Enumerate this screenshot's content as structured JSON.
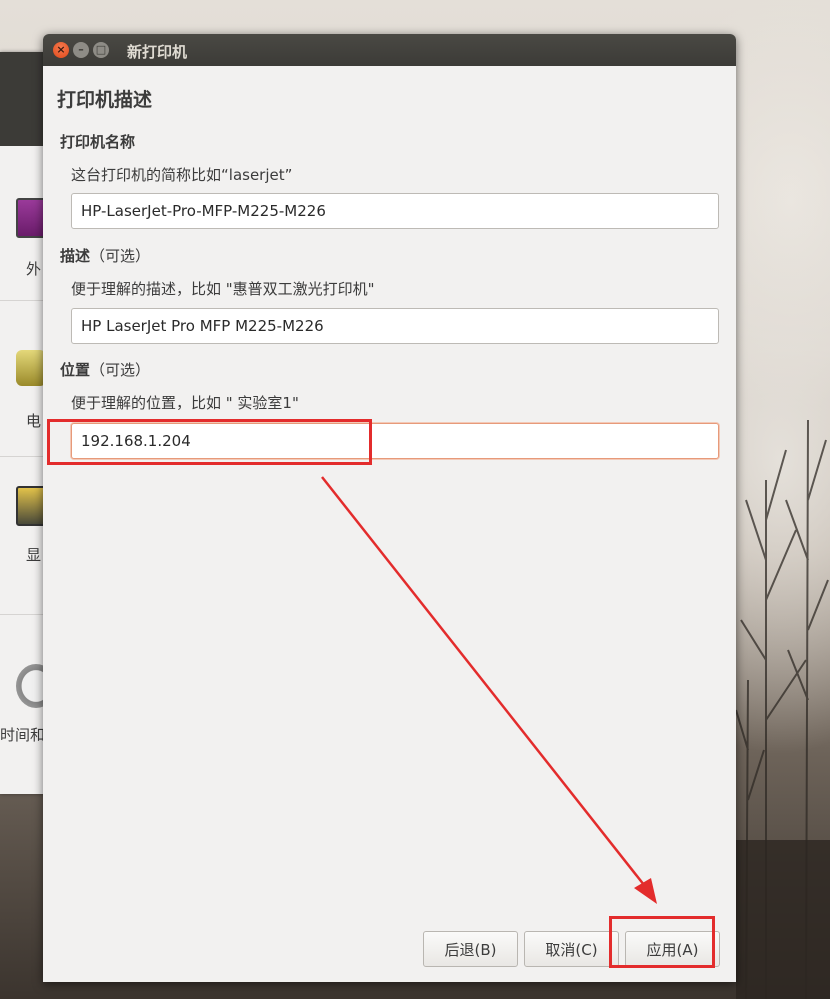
{
  "dialog": {
    "title": "新打印机",
    "heading": "打印机描述",
    "name_section": {
      "label": "打印机名称",
      "hint": "这台打印机的简称比如“laserjet”",
      "value": "HP-LaserJet-Pro-MFP-M225-M226"
    },
    "description_section": {
      "label_bold": "描述",
      "label_optional": "（可选）",
      "hint": "便于理解的描述，比如 \"惠普双工激光打印机\"",
      "value": "HP LaserJet Pro MFP M225-M226"
    },
    "location_section": {
      "label_bold": "位置",
      "label_optional": "（可选）",
      "hint": "便于理解的位置，比如 \" 实验室1\"",
      "value": "192.168.1.204"
    },
    "buttons": {
      "back": "后退(B)",
      "cancel": "取消(C)",
      "apply": "应用(A)"
    }
  },
  "background_window": {
    "items": [
      "外",
      "电",
      "显",
      "时间和"
    ]
  },
  "colors": {
    "annotation": "#e32c2c",
    "titlebar": "#3c3b37",
    "close_button": "#e95420"
  },
  "icons": [
    "close-icon",
    "minimize-icon",
    "maximize-icon",
    "monitor-icon",
    "battery-icon",
    "display-icon",
    "clock-icon"
  ]
}
